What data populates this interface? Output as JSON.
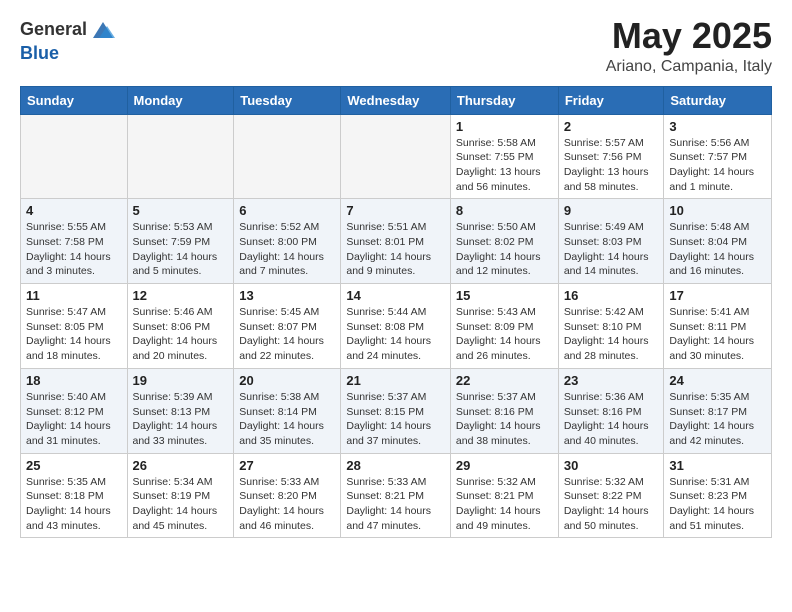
{
  "logo": {
    "general": "General",
    "blue": "Blue"
  },
  "title": "May 2025",
  "subtitle": "Ariano, Campania, Italy",
  "weekdays": [
    "Sunday",
    "Monday",
    "Tuesday",
    "Wednesday",
    "Thursday",
    "Friday",
    "Saturday"
  ],
  "weeks": [
    [
      {
        "day": "",
        "info": ""
      },
      {
        "day": "",
        "info": ""
      },
      {
        "day": "",
        "info": ""
      },
      {
        "day": "",
        "info": ""
      },
      {
        "day": "1",
        "info": "Sunrise: 5:58 AM\nSunset: 7:55 PM\nDaylight: 13 hours\nand 56 minutes."
      },
      {
        "day": "2",
        "info": "Sunrise: 5:57 AM\nSunset: 7:56 PM\nDaylight: 13 hours\nand 58 minutes."
      },
      {
        "day": "3",
        "info": "Sunrise: 5:56 AM\nSunset: 7:57 PM\nDaylight: 14 hours\nand 1 minute."
      }
    ],
    [
      {
        "day": "4",
        "info": "Sunrise: 5:55 AM\nSunset: 7:58 PM\nDaylight: 14 hours\nand 3 minutes."
      },
      {
        "day": "5",
        "info": "Sunrise: 5:53 AM\nSunset: 7:59 PM\nDaylight: 14 hours\nand 5 minutes."
      },
      {
        "day": "6",
        "info": "Sunrise: 5:52 AM\nSunset: 8:00 PM\nDaylight: 14 hours\nand 7 minutes."
      },
      {
        "day": "7",
        "info": "Sunrise: 5:51 AM\nSunset: 8:01 PM\nDaylight: 14 hours\nand 9 minutes."
      },
      {
        "day": "8",
        "info": "Sunrise: 5:50 AM\nSunset: 8:02 PM\nDaylight: 14 hours\nand 12 minutes."
      },
      {
        "day": "9",
        "info": "Sunrise: 5:49 AM\nSunset: 8:03 PM\nDaylight: 14 hours\nand 14 minutes."
      },
      {
        "day": "10",
        "info": "Sunrise: 5:48 AM\nSunset: 8:04 PM\nDaylight: 14 hours\nand 16 minutes."
      }
    ],
    [
      {
        "day": "11",
        "info": "Sunrise: 5:47 AM\nSunset: 8:05 PM\nDaylight: 14 hours\nand 18 minutes."
      },
      {
        "day": "12",
        "info": "Sunrise: 5:46 AM\nSunset: 8:06 PM\nDaylight: 14 hours\nand 20 minutes."
      },
      {
        "day": "13",
        "info": "Sunrise: 5:45 AM\nSunset: 8:07 PM\nDaylight: 14 hours\nand 22 minutes."
      },
      {
        "day": "14",
        "info": "Sunrise: 5:44 AM\nSunset: 8:08 PM\nDaylight: 14 hours\nand 24 minutes."
      },
      {
        "day": "15",
        "info": "Sunrise: 5:43 AM\nSunset: 8:09 PM\nDaylight: 14 hours\nand 26 minutes."
      },
      {
        "day": "16",
        "info": "Sunrise: 5:42 AM\nSunset: 8:10 PM\nDaylight: 14 hours\nand 28 minutes."
      },
      {
        "day": "17",
        "info": "Sunrise: 5:41 AM\nSunset: 8:11 PM\nDaylight: 14 hours\nand 30 minutes."
      }
    ],
    [
      {
        "day": "18",
        "info": "Sunrise: 5:40 AM\nSunset: 8:12 PM\nDaylight: 14 hours\nand 31 minutes."
      },
      {
        "day": "19",
        "info": "Sunrise: 5:39 AM\nSunset: 8:13 PM\nDaylight: 14 hours\nand 33 minutes."
      },
      {
        "day": "20",
        "info": "Sunrise: 5:38 AM\nSunset: 8:14 PM\nDaylight: 14 hours\nand 35 minutes."
      },
      {
        "day": "21",
        "info": "Sunrise: 5:37 AM\nSunset: 8:15 PM\nDaylight: 14 hours\nand 37 minutes."
      },
      {
        "day": "22",
        "info": "Sunrise: 5:37 AM\nSunset: 8:16 PM\nDaylight: 14 hours\nand 38 minutes."
      },
      {
        "day": "23",
        "info": "Sunrise: 5:36 AM\nSunset: 8:16 PM\nDaylight: 14 hours\nand 40 minutes."
      },
      {
        "day": "24",
        "info": "Sunrise: 5:35 AM\nSunset: 8:17 PM\nDaylight: 14 hours\nand 42 minutes."
      }
    ],
    [
      {
        "day": "25",
        "info": "Sunrise: 5:35 AM\nSunset: 8:18 PM\nDaylight: 14 hours\nand 43 minutes."
      },
      {
        "day": "26",
        "info": "Sunrise: 5:34 AM\nSunset: 8:19 PM\nDaylight: 14 hours\nand 45 minutes."
      },
      {
        "day": "27",
        "info": "Sunrise: 5:33 AM\nSunset: 8:20 PM\nDaylight: 14 hours\nand 46 minutes."
      },
      {
        "day": "28",
        "info": "Sunrise: 5:33 AM\nSunset: 8:21 PM\nDaylight: 14 hours\nand 47 minutes."
      },
      {
        "day": "29",
        "info": "Sunrise: 5:32 AM\nSunset: 8:21 PM\nDaylight: 14 hours\nand 49 minutes."
      },
      {
        "day": "30",
        "info": "Sunrise: 5:32 AM\nSunset: 8:22 PM\nDaylight: 14 hours\nand 50 minutes."
      },
      {
        "day": "31",
        "info": "Sunrise: 5:31 AM\nSunset: 8:23 PM\nDaylight: 14 hours\nand 51 minutes."
      }
    ]
  ]
}
